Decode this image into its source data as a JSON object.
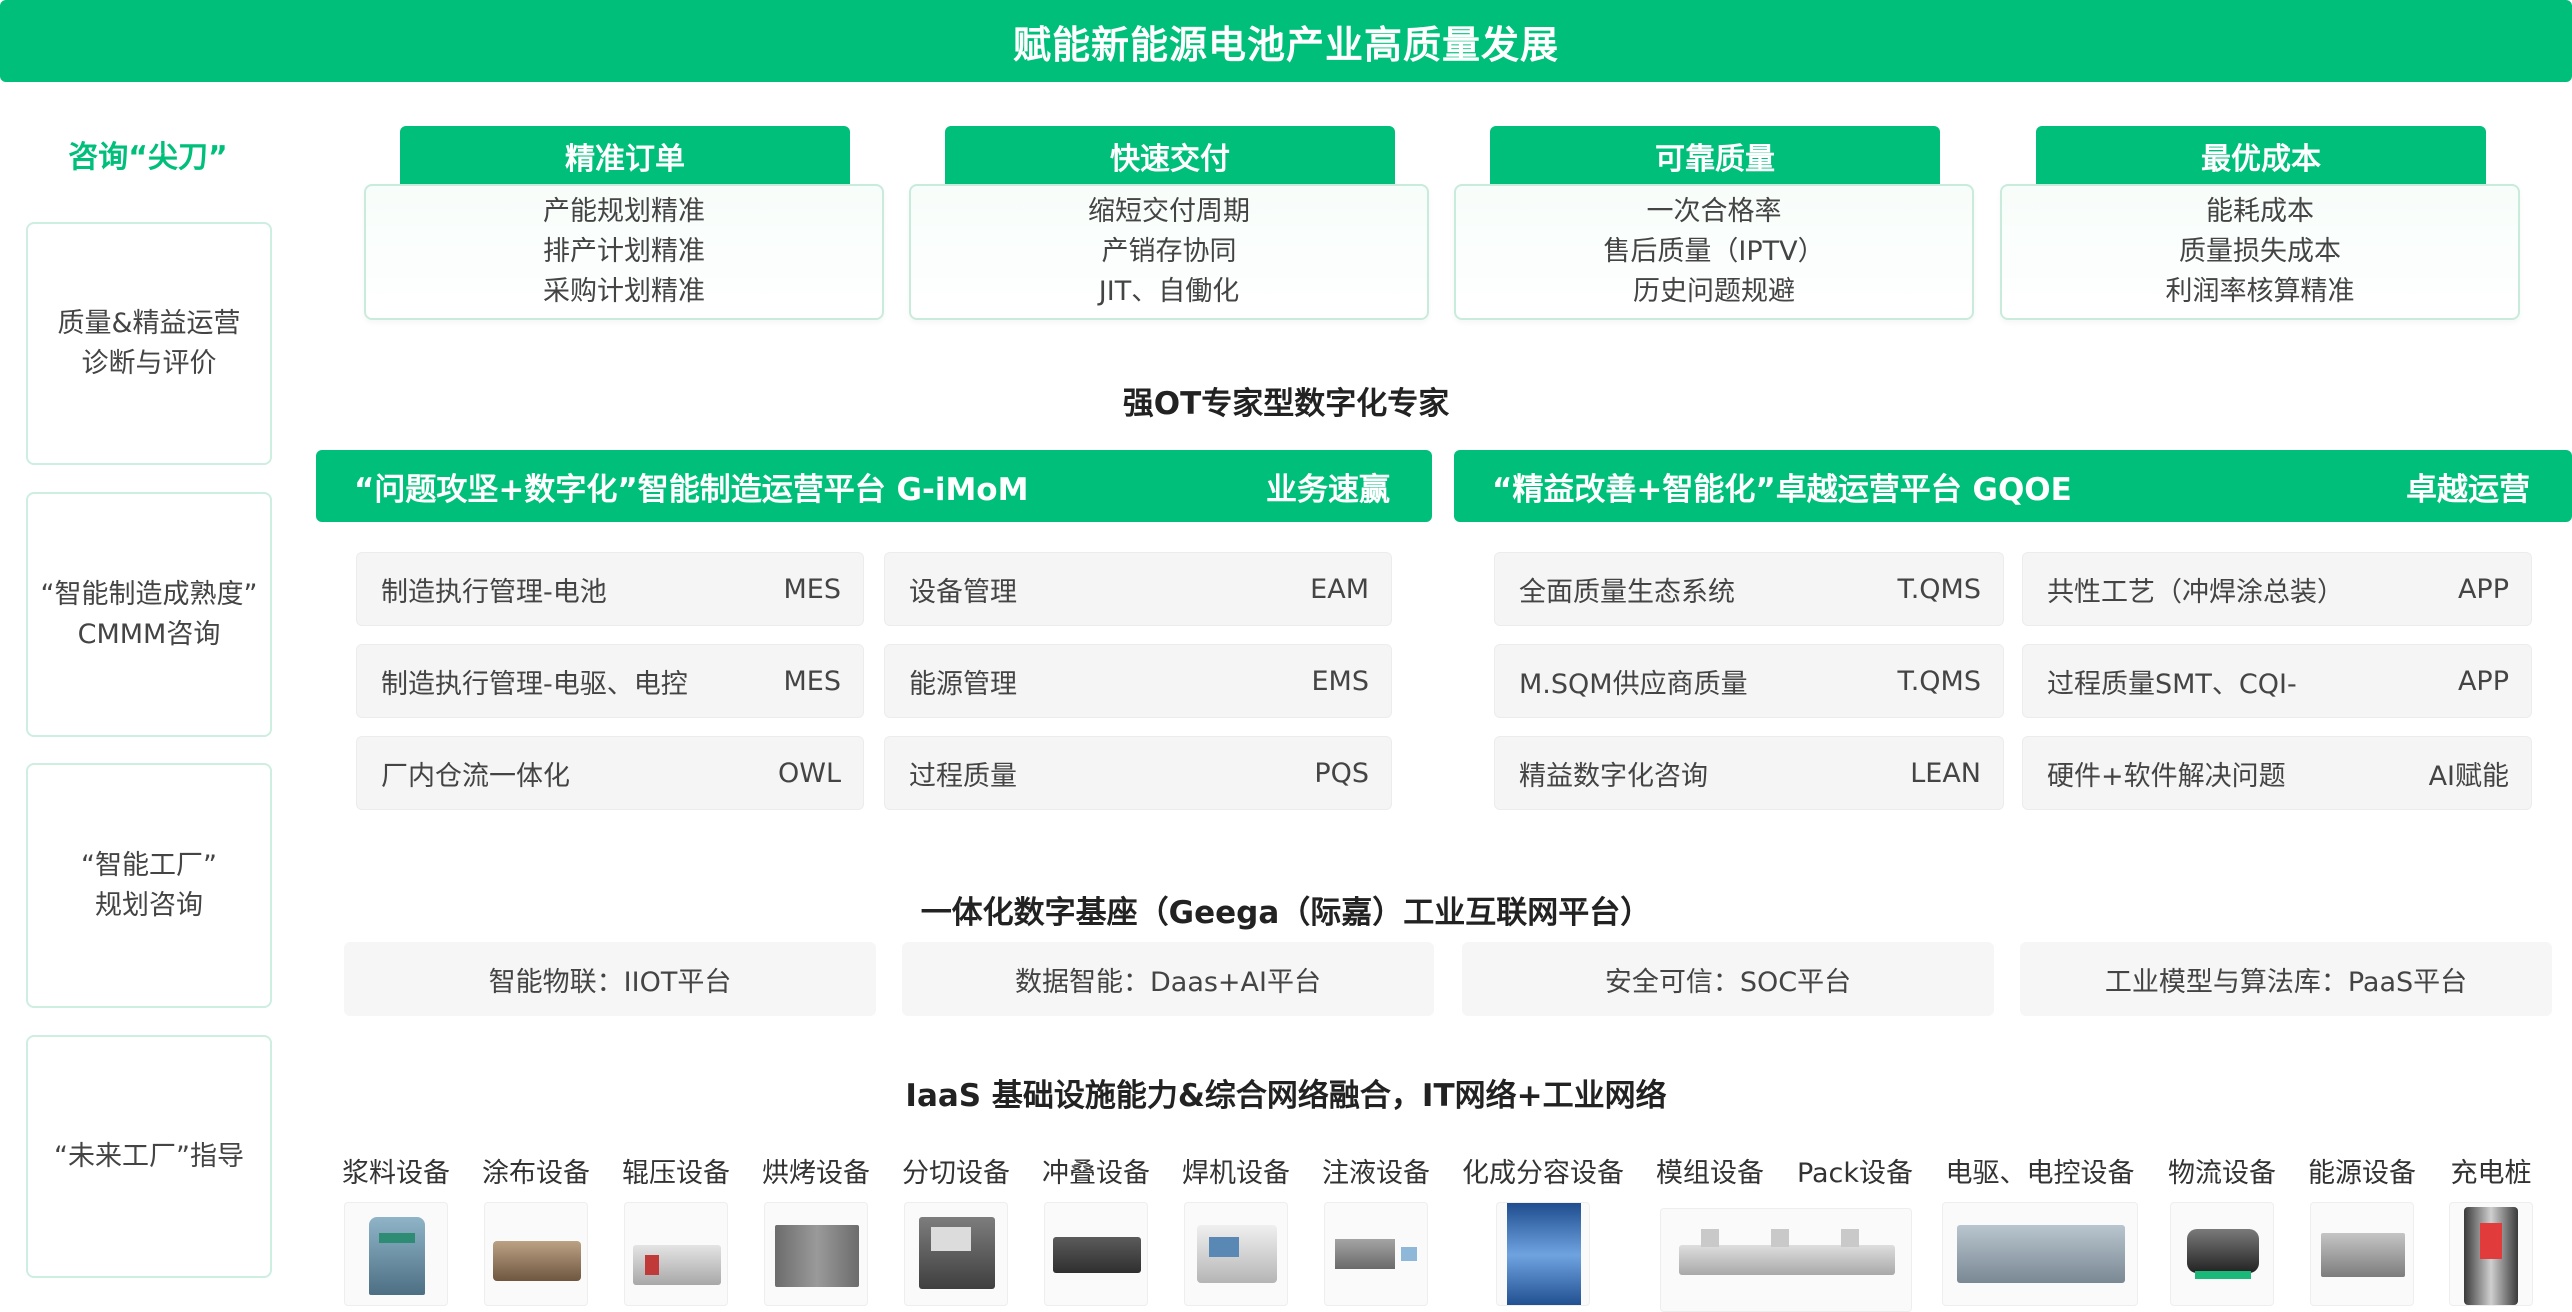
{
  "banner": {
    "title": "赋能新能源电池产业高质量发展"
  },
  "left": {
    "title": "咨询“尖刀”",
    "cards": [
      {
        "line1": "质量&精益运营",
        "line2": "诊断与评价"
      },
      {
        "line1": "“智能制造成熟度”",
        "line2": "CMMM咨询"
      },
      {
        "line1": "“智能工厂”",
        "line2": "规划咨询"
      },
      {
        "line1": "“未来工厂”指导",
        "line2": ""
      }
    ]
  },
  "goals": [
    {
      "title": "精准订单",
      "items": [
        "产能规划精准",
        "排产计划精准",
        "采购计划精准"
      ]
    },
    {
      "title": "快速交付",
      "items": [
        "缩短交付周期",
        "产销存协同",
        "JIT、自働化"
      ]
    },
    {
      "title": "可靠质量",
      "items": [
        "一次合格率",
        "售后质量（IPTV）",
        "历史问题规避"
      ]
    },
    {
      "title": "最优成本",
      "items": [
        "能耗成本",
        "质量损失成本",
        "利润率核算精准"
      ]
    }
  ],
  "expert_title": "强OT专家型数字化专家",
  "platforms": [
    {
      "name": "“问题攻坚+数字化”智能制造运营平台 G-iMoM",
      "tag": "业务速赢",
      "modules": [
        {
          "name": "制造执行管理-电池",
          "code": "MES"
        },
        {
          "name": "设备管理",
          "code": "EAM"
        },
        {
          "name": "制造执行管理-电驱、电控",
          "code": "MES"
        },
        {
          "name": "能源管理",
          "code": "EMS"
        },
        {
          "name": "厂内仓流一体化",
          "code": "OWL"
        },
        {
          "name": "过程质量",
          "code": "PQS"
        }
      ]
    },
    {
      "name": "“精益改善+智能化”卓越运营平台 GQOE",
      "tag": "卓越运营",
      "modules": [
        {
          "name": "全面质量生态系统",
          "code": "T.QMS"
        },
        {
          "name": "共性工艺（冲焊涂总装）",
          "code": "APP"
        },
        {
          "name": "M.SQM供应商质量",
          "code": "T.QMS"
        },
        {
          "name": "过程质量SMT、CQI-",
          "code": "APP"
        },
        {
          "name": "精益数字化咨询",
          "code": "LEAN"
        },
        {
          "name": "硬件+软件解决问题",
          "code": "AI赋能"
        }
      ]
    }
  ],
  "base": {
    "title": "一体化数字基座（Geega（际嘉）工业互联网平台）",
    "items": [
      "智能物联：IIOT平台",
      "数据智能：Daas+AI平台",
      "安全可信：SOC平台",
      "工业模型与算法库：PaaS平台"
    ]
  },
  "iaas": {
    "title": "IaaS 基础设施能力&综合网络融合，IT网络+工业网络"
  },
  "equipment": [
    "浆料设备",
    "涂布设备",
    "辊压设备",
    "烘烤设备",
    "分切设备",
    "冲叠设备",
    "焊机设备",
    "注液设备",
    "化成分容设备",
    "模组设备",
    "Pack设备",
    "电驱、电控设备",
    "物流设备",
    "能源设备",
    "充电桩"
  ],
  "colors": {
    "accent": "#00bf7a",
    "card_border": "#c9ebdc",
    "module_bg": "#f5f5f5"
  }
}
